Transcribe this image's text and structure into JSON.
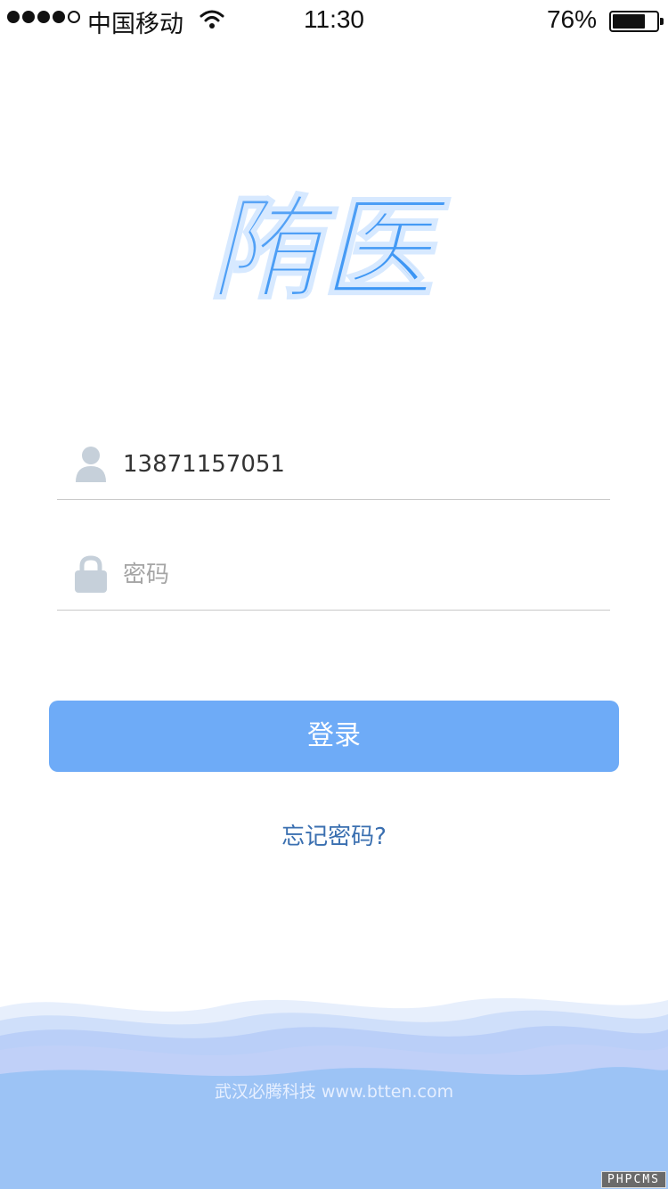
{
  "status_bar": {
    "carrier": "中国移动",
    "time": "11:30",
    "battery_percent_text": "76%",
    "battery_level": 0.76,
    "signal_bars_filled": 4,
    "signal_bars_total": 5
  },
  "logo": {
    "text": "陏医",
    "color": "#3b98f5"
  },
  "form": {
    "phone_value": "13871157051",
    "password_placeholder": "密码",
    "login_label": "登录",
    "forgot_label": "忘记密码?"
  },
  "footer": {
    "text": "武汉必腾科技 www.btten.com",
    "watermark": "PHPCMS"
  },
  "colors": {
    "accent": "#6eabf7",
    "link": "#3a6fb0",
    "icon": "#c6d0da",
    "wave": "#9cc3f5"
  }
}
